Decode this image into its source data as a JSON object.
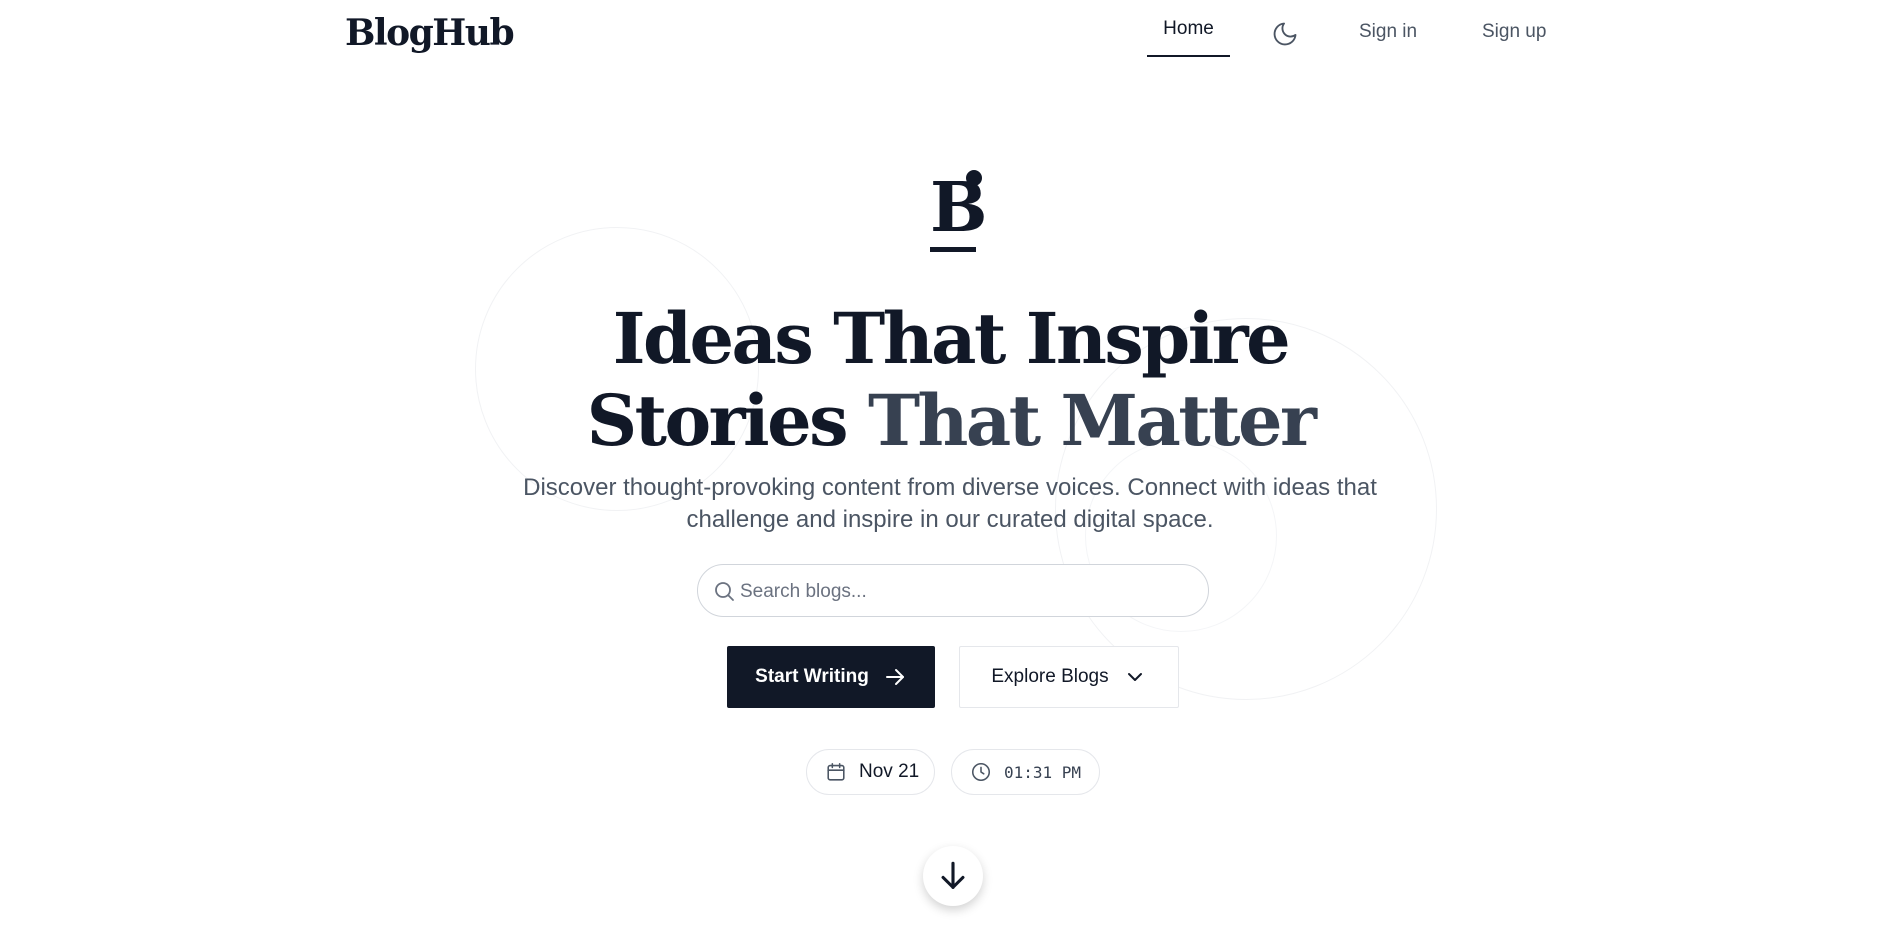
{
  "nav": {
    "brand": "BlogHub",
    "home_label": "Home",
    "signin_label": "Sign in",
    "signup_label": "Sign up",
    "theme_icon": "moon-icon"
  },
  "hero": {
    "mark_letter": "B",
    "title_line1": "Ideas That Inspire",
    "title_line2_a": "Stories ",
    "title_line2_b": "That Matter",
    "subtitle": "Discover thought-provoking content from diverse voices. Connect with ideas that challenge and inspire in our curated digital space."
  },
  "search": {
    "placeholder": "Search blogs...",
    "value": "",
    "icon": "search-icon"
  },
  "actions": {
    "start_writing_label": "Start Writing",
    "start_writing_icon": "arrow-right-icon",
    "explore_label": "Explore Blogs",
    "explore_icon": "chevron-down-icon"
  },
  "meta": {
    "date": "Nov 21",
    "date_icon": "calendar-icon",
    "time": "01:31 PM",
    "time_icon": "clock-icon"
  },
  "scroll": {
    "icon": "arrow-down-icon"
  },
  "colors": {
    "primary": "#111827",
    "text_muted": "#4b5563",
    "accent_text": "#374151",
    "border": "#e5e7eb",
    "background": "#ffffff"
  }
}
